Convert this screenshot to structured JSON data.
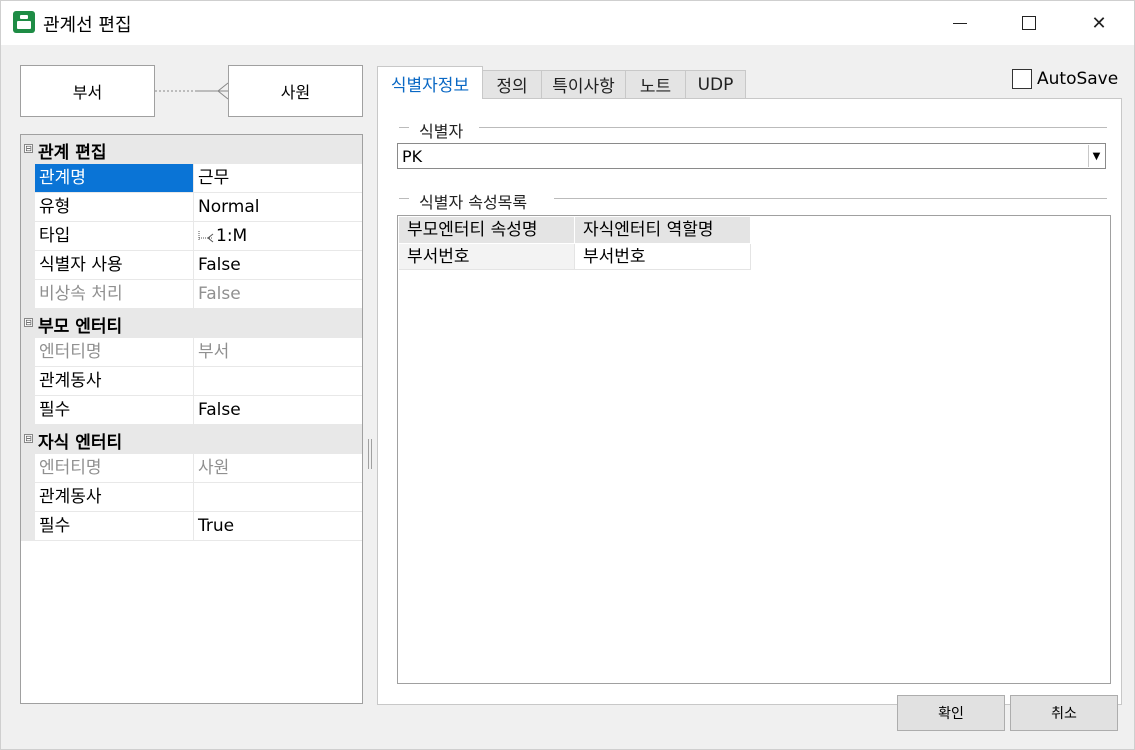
{
  "window": {
    "title": "관계선 편집",
    "close_glyph": "✕"
  },
  "diagram": {
    "parent_entity": "부서",
    "child_entity": "사원"
  },
  "properties": {
    "relation_section": {
      "label": "관계 편집",
      "toggle": "⊟",
      "rows": [
        {
          "name": "관계명",
          "value": "근무"
        },
        {
          "name": "유형",
          "value": "Normal"
        },
        {
          "name": "타입",
          "value": "1:M"
        },
        {
          "name": "식별자 사용",
          "value": "False"
        },
        {
          "name": "비상속 처리",
          "value": "False"
        }
      ]
    },
    "parent_section": {
      "label": "부모 엔터티",
      "toggle": "⊟",
      "rows": [
        {
          "name": "엔터티명",
          "value": "부서"
        },
        {
          "name": "관계동사",
          "value": ""
        },
        {
          "name": "필수",
          "value": "False"
        }
      ]
    },
    "child_section": {
      "label": "자식 엔터티",
      "toggle": "⊟",
      "rows": [
        {
          "name": "엔터티명",
          "value": "사원"
        },
        {
          "name": "관계동사",
          "value": ""
        },
        {
          "name": "필수",
          "value": "True"
        }
      ]
    }
  },
  "tabs": [
    "식별자정보",
    "정의",
    "특이사항",
    "노트",
    "UDP"
  ],
  "autosave": {
    "label": "AutoSave",
    "checked": false
  },
  "identifier": {
    "group_label": "식별자",
    "selected": "PK",
    "arrow": "▼"
  },
  "attribute_list": {
    "group_label": "식별자 속성목록",
    "columns": [
      "부모엔터티 속성명",
      "자식엔터티 역할명"
    ],
    "rows": [
      [
        "부서번호",
        "부서번호"
      ]
    ]
  },
  "buttons": {
    "ok": "확인",
    "cancel": "취소"
  },
  "colors": {
    "selection": "#0a74d6",
    "active_tab_text": "#0a68c4",
    "app_icon": "#1e8c45"
  }
}
